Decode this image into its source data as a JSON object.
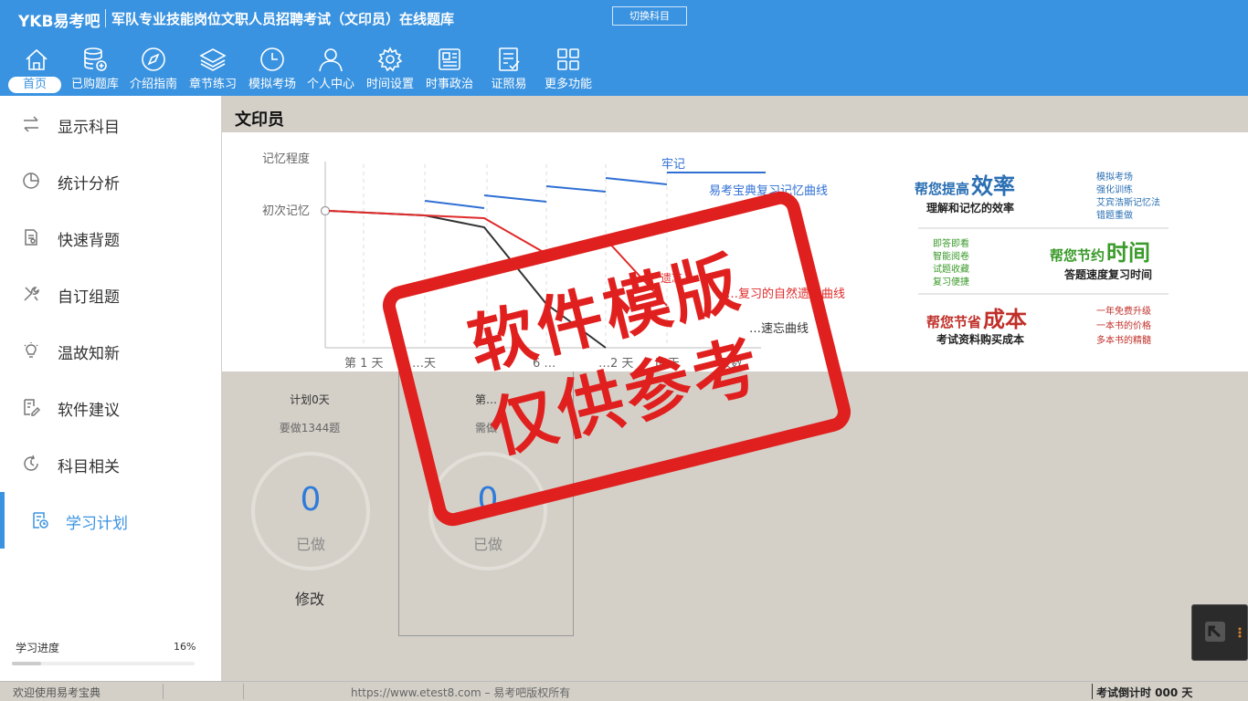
{
  "header": {
    "logo": "YKB易考吧",
    "title": "军队专业技能岗位文职人员招聘考试（文印员）在线题库",
    "switch_label": "切换科目",
    "nav": [
      {
        "label": "首页",
        "icon": "home-icon",
        "active": true
      },
      {
        "label": "已购题库",
        "icon": "database-icon"
      },
      {
        "label": "介绍指南",
        "icon": "compass-icon"
      },
      {
        "label": "章节练习",
        "icon": "layers-icon"
      },
      {
        "label": "模拟考场",
        "icon": "clock-icon"
      },
      {
        "label": "个人中心",
        "icon": "user-icon"
      },
      {
        "label": "时间设置",
        "icon": "gear-icon"
      },
      {
        "label": "时事政治",
        "icon": "newspaper-icon"
      },
      {
        "label": "证照易",
        "icon": "checklist-icon"
      },
      {
        "label": "更多功能",
        "icon": "grid-icon"
      }
    ]
  },
  "sidebar": {
    "items": [
      {
        "label": "显示科目",
        "icon": "swap-icon"
      },
      {
        "label": "统计分析",
        "icon": "pie-chart-icon"
      },
      {
        "label": "快速背题",
        "icon": "document-icon"
      },
      {
        "label": "自订组题",
        "icon": "tools-icon"
      },
      {
        "label": "温故知新",
        "icon": "lightbulb-icon"
      },
      {
        "label": "软件建议",
        "icon": "edit-icon"
      },
      {
        "label": "科目相关",
        "icon": "clock-refresh-icon"
      },
      {
        "label": "学习计划",
        "icon": "plan-icon",
        "active": true
      }
    ],
    "progress_label": "学习进度",
    "progress_text": "16%",
    "progress_fraction": 0.16
  },
  "main": {
    "title": "文印员"
  },
  "banner": {
    "y_top": "记忆程度",
    "y_first": "初次记忆",
    "x_labels": [
      "第 1 天",
      "…天",
      "6 …",
      "…2 天",
      "N 天",
      "天数"
    ],
    "solid_label": "牢记",
    "blue_label": "易考宝典复习记忆曲线",
    "red_label_a": "遗忘",
    "red_label_b": "…复习的自然遗…曲线",
    "black_label": "…速忘曲线",
    "promo": {
      "p1_prefix": "帮您提高",
      "p1_big": "效率",
      "p1_sub": "理解和记忆的效率",
      "p1_list": [
        "模拟考场",
        "强化训练",
        "艾宾浩斯记忆法",
        "错题重做"
      ],
      "p2_list": [
        "即答即看",
        "智能阅卷",
        "试题收藏",
        "复习便捷"
      ],
      "p2_prefix": "帮您节约",
      "p2_big": "时间",
      "p2_sub": "答题速度复习时间",
      "p3_prefix": "帮您节省",
      "p3_big": "成本",
      "p3_sub": "考试资料购买成本",
      "p3_list": [
        "一年免费升级",
        "一本书的价格",
        "多本书的精髓"
      ]
    }
  },
  "plan": {
    "cards": [
      {
        "title": "计划0天",
        "sub": "要做1344题",
        "count": "0",
        "done": "已做",
        "modify": "修改"
      },
      {
        "title": "第…",
        "sub": "需做",
        "count": "0",
        "done": "已做"
      }
    ]
  },
  "stamp": {
    "line1": "软件模版",
    "line2": "仅供参考"
  },
  "footer": {
    "welcome": "欢迎使用易考宝典",
    "copyright": "https://www.etest8.com – 易考吧版权所有",
    "countdown": "考试倒计时 000 天"
  },
  "colors": {
    "header_bg": "#3a93e0",
    "accent": "#3a93e0",
    "stamp_red": "#e0201e",
    "curve_blue": "#2f6fd4",
    "curve_red": "#e02a2a"
  }
}
